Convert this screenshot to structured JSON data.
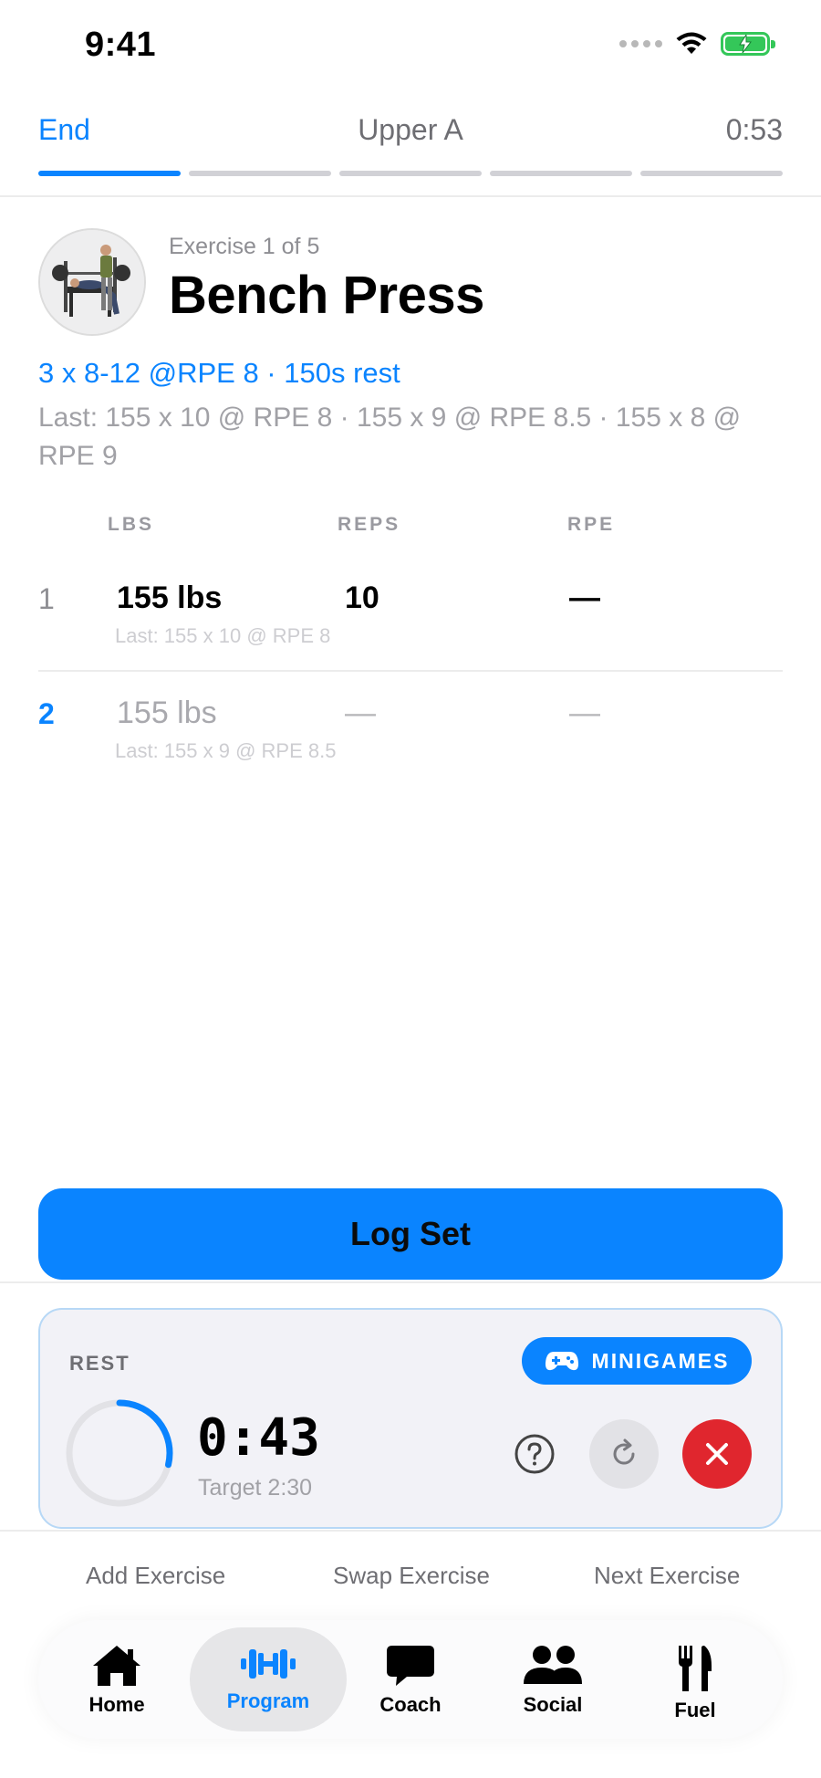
{
  "status_bar": {
    "time": "9:41"
  },
  "workout": {
    "end_label": "End",
    "title": "Upper A",
    "elapsed": "0:53",
    "progress_total_exercises": 5,
    "progress_current_exercise": 1
  },
  "exercise": {
    "counter": "Exercise 1 of 5",
    "name": "Bench Press",
    "scheme": "3 x 8-12 @RPE 8 · 150s rest",
    "last_session": "Last: 155 x 10 @ RPE 8 · 155 x 9 @ RPE 8.5 · 155 x 8 @ RPE 9"
  },
  "set_table": {
    "headers": {
      "lbs": "LBS",
      "reps": "REPS",
      "rpe": "RPE"
    },
    "rows": [
      {
        "number": "1",
        "lbs": "155 lbs",
        "reps": "10",
        "rpe": "—",
        "last": "Last: 155 x 10 @ RPE 8"
      },
      {
        "number": "2",
        "lbs": "155 lbs",
        "reps": "—",
        "rpe": "—",
        "last": "Last: 155 x 9 @ RPE 8.5"
      }
    ]
  },
  "log_button_label": "Log Set",
  "rest": {
    "label": "REST",
    "minigames_label": "MINIGAMES",
    "time": "0:43",
    "target": "Target 2:30",
    "elapsed_fraction": 0.287
  },
  "actions": {
    "add": "Add Exercise",
    "swap": "Swap Exercise",
    "next": "Next Exercise"
  },
  "tabs": [
    {
      "label": "Home",
      "icon": "house-icon"
    },
    {
      "label": "Program",
      "icon": "dumbbell-icon",
      "active": true
    },
    {
      "label": "Coach",
      "icon": "chat-bubble-icon"
    },
    {
      "label": "Social",
      "icon": "people-icon"
    },
    {
      "label": "Fuel",
      "icon": "fork-knife-icon"
    }
  ],
  "colors": {
    "accent": "#0a84ff",
    "battery": "#34c759",
    "cancel": "#e0262e",
    "muted_text": "#8e8e93"
  }
}
